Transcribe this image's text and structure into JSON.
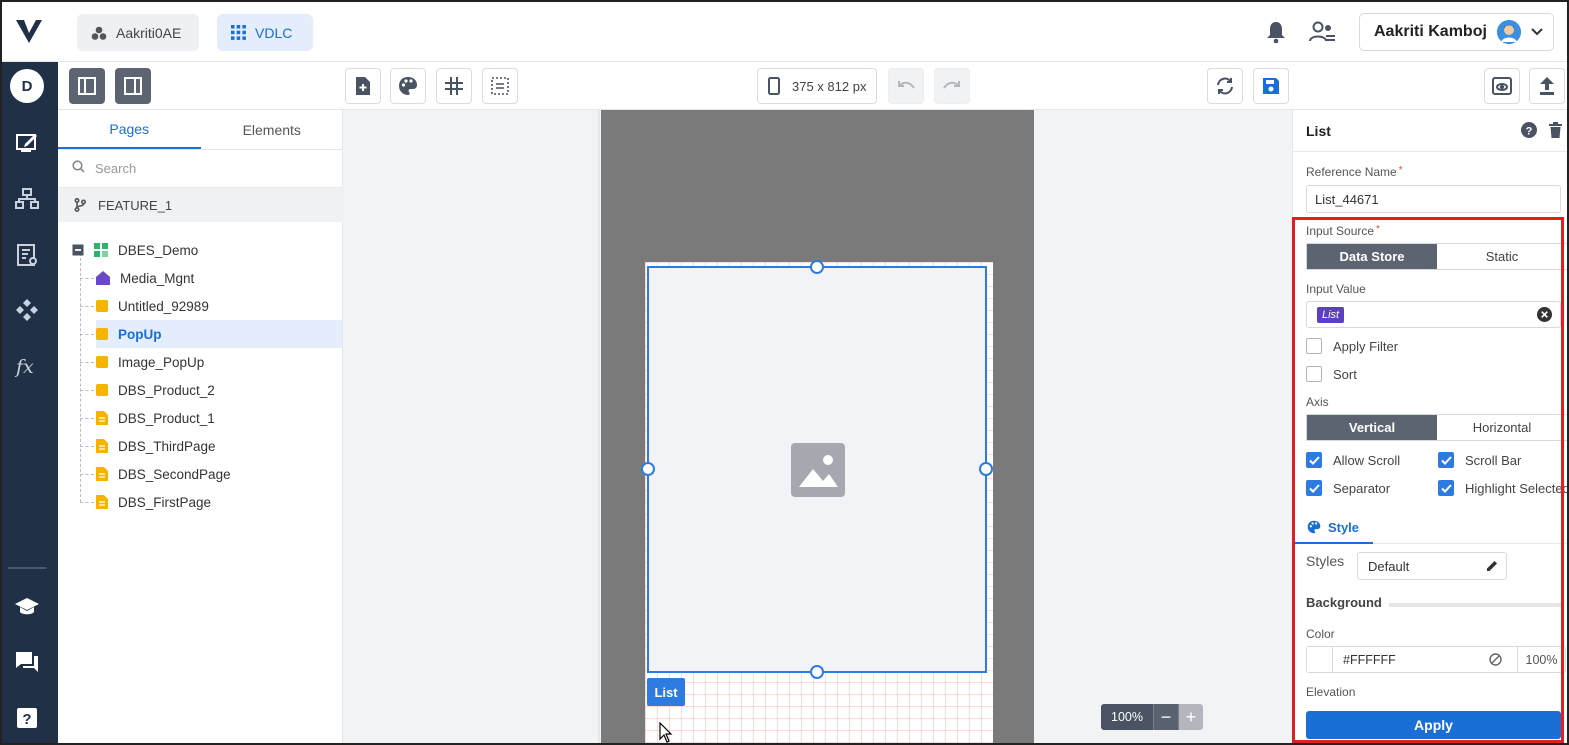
{
  "header": {
    "project": "Aakriti0AE",
    "app": "VDLC",
    "user_name": "Aakriti Kamboj"
  },
  "leftnav": {
    "avatar_letter": "D"
  },
  "toolbar": {
    "device_size": "375 x 812 px"
  },
  "pages_panel": {
    "tabs": [
      "Pages",
      "Elements"
    ],
    "search_placeholder": "Search",
    "feature": "FEATURE_1",
    "root": "DBES_Demo",
    "items": [
      "Media_Mgnt",
      "Untitled_92989",
      "PopUp",
      "Image_PopUp",
      "DBS_Product_2",
      "DBS_Product_1",
      "DBS_ThirdPage",
      "DBS_SecondPage",
      "DBS_FirstPage"
    ],
    "selected": "PopUp"
  },
  "canvas": {
    "list_tag": "List",
    "zoom": "100%"
  },
  "props": {
    "title": "List",
    "reference_name_label": "Reference Name",
    "reference_name_value": "List_44671",
    "input_source_label": "Input Source",
    "input_source_options": [
      "Data Store",
      "Static"
    ],
    "input_value_label": "Input Value",
    "input_value_pill": "List",
    "apply_filter": "Apply Filter",
    "sort": "Sort",
    "axis_label": "Axis",
    "axis_options": [
      "Vertical",
      "Horizontal"
    ],
    "allow_scroll": "Allow Scroll",
    "scroll_bar": "Scroll Bar",
    "separator": "Separator",
    "highlight_selected": "Highlight Selected",
    "style_tab": "Style",
    "styles_label": "Styles",
    "styles_value": "Default",
    "background_label": "Background",
    "color_label": "Color",
    "color_value": "#FFFFFF",
    "opacity": "100%",
    "elevation_label": "Elevation",
    "apply_label": "Apply"
  },
  "colors": {
    "accent": "#1a6fd6",
    "nav_bg": "#1f3047",
    "selection": "#2d7be0",
    "highlight_box": "#e02020"
  }
}
